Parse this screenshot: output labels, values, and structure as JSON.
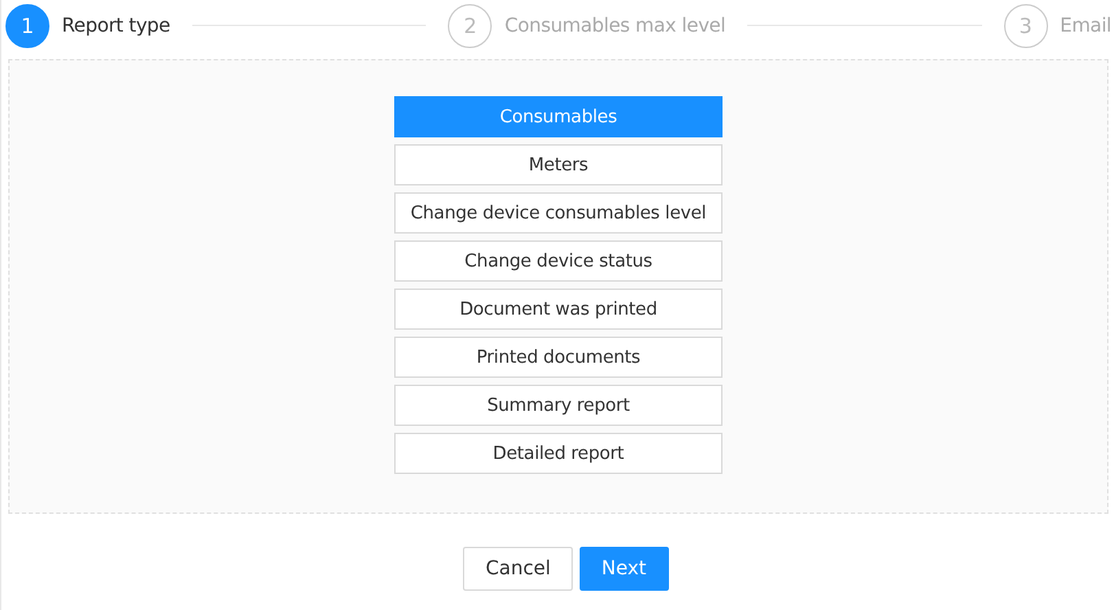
{
  "steps": [
    {
      "number": "1",
      "label": "Report type",
      "selected": true
    },
    {
      "number": "2",
      "label": "Consumables max level",
      "selected": false
    },
    {
      "number": "3",
      "label": "Email",
      "selected": false
    }
  ],
  "report_types": [
    {
      "label": "Consumables",
      "selected": true
    },
    {
      "label": "Meters",
      "selected": false
    },
    {
      "label": "Change device consumables level",
      "selected": false
    },
    {
      "label": "Change device status",
      "selected": false
    },
    {
      "label": "Document was printed",
      "selected": false
    },
    {
      "label": "Printed documents",
      "selected": false
    },
    {
      "label": "Summary report",
      "selected": false
    },
    {
      "label": "Detailed report",
      "selected": false
    }
  ],
  "buttons": [
    {
      "label": "Cancel",
      "kind": "default"
    },
    {
      "label": "Next",
      "kind": "primary"
    }
  ]
}
